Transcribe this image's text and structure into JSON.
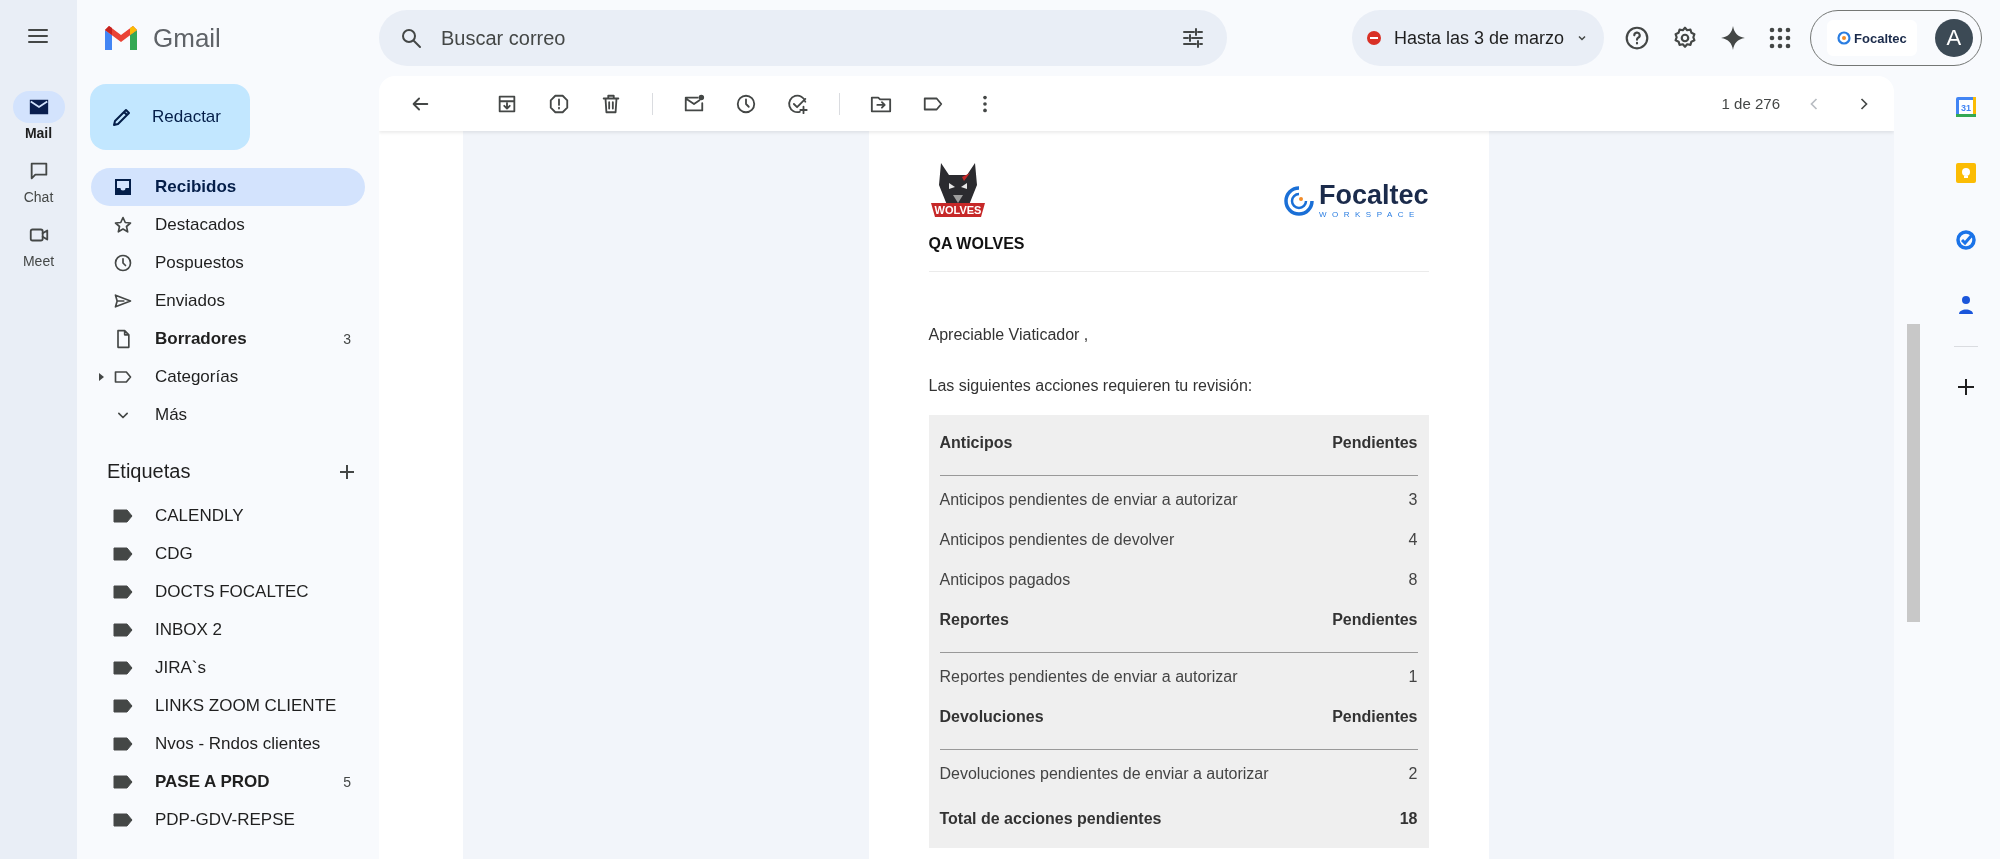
{
  "rail": [
    {
      "label": "Mail",
      "kind": "mail",
      "selected": true
    },
    {
      "label": "Chat",
      "kind": "chat",
      "selected": false
    },
    {
      "label": "Meet",
      "kind": "meet",
      "selected": false
    }
  ],
  "app_name": "Gmail",
  "compose_button": "Redactar",
  "search": {
    "placeholder": "Buscar correo"
  },
  "status_chip": "Hasta las 3 de marzo",
  "account": {
    "org": "Focaltec",
    "avatar": "A"
  },
  "folders": [
    {
      "label": "Recibidos",
      "kind": "inbox",
      "selected": true,
      "unread": true
    },
    {
      "label": "Destacados",
      "kind": "starred",
      "selected": false,
      "unread": false
    },
    {
      "label": "Pospuestos",
      "kind": "snoozed",
      "selected": false,
      "unread": false
    },
    {
      "label": "Enviados",
      "kind": "sent",
      "selected": false,
      "unread": false
    },
    {
      "label": "Borradores",
      "kind": "drafts",
      "selected": false,
      "unread": true,
      "count": "3"
    },
    {
      "label": "Categorías",
      "kind": "categories",
      "selected": false,
      "unread": false,
      "expanded": false
    },
    {
      "label": "Más",
      "kind": "more",
      "selected": false,
      "unread": false
    }
  ],
  "labels": {
    "title": "Etiquetas",
    "items": [
      {
        "label": "CALENDLY",
        "unread": false
      },
      {
        "label": "CDG",
        "unread": false
      },
      {
        "label": "DOCTS FOCALTEC",
        "unread": false
      },
      {
        "label": "INBOX 2",
        "unread": false
      },
      {
        "label": "JIRA`s",
        "unread": false
      },
      {
        "label": "LINKS ZOOM CLIENTE",
        "unread": false
      },
      {
        "label": "Nvos - Rndos clientes",
        "unread": false
      },
      {
        "label": "PASE A PROD",
        "unread": true,
        "count": "5"
      },
      {
        "label": "PDP-GDV-REPSE",
        "unread": false
      }
    ]
  },
  "pager": {
    "text": "1 de 276",
    "prev_disabled": true,
    "next_disabled": false
  },
  "side_apps": {
    "calendar_day": "31"
  },
  "email": {
    "logo_badge": "WOLVES",
    "brand": "Focaltec",
    "brand_sub": "WORKSPACE",
    "team": "QA WOLVES",
    "greeting": "Apreciable Viaticador ,",
    "intro": "Las siguientes acciones requieren tu revisión:",
    "sections": [
      {
        "title": "Anticipos",
        "column": "Pendientes",
        "rows": [
          {
            "label": "Anticipos pendientes de enviar a autorizar",
            "value": "3"
          },
          {
            "label": "Anticipos pendientes de devolver",
            "value": "4"
          },
          {
            "label": "Anticipos pagados",
            "value": "8"
          }
        ]
      },
      {
        "title": "Reportes",
        "column": "Pendientes",
        "rows": [
          {
            "label": "Reportes pendientes de enviar a autorizar",
            "value": "1"
          }
        ]
      },
      {
        "title": "Devoluciones",
        "column": "Pendientes",
        "rows": [
          {
            "label": "Devoluciones pendientes de enviar a autorizar",
            "value": "2"
          }
        ]
      }
    ],
    "total": {
      "label": "Total de acciones pendientes",
      "value": "18"
    }
  }
}
